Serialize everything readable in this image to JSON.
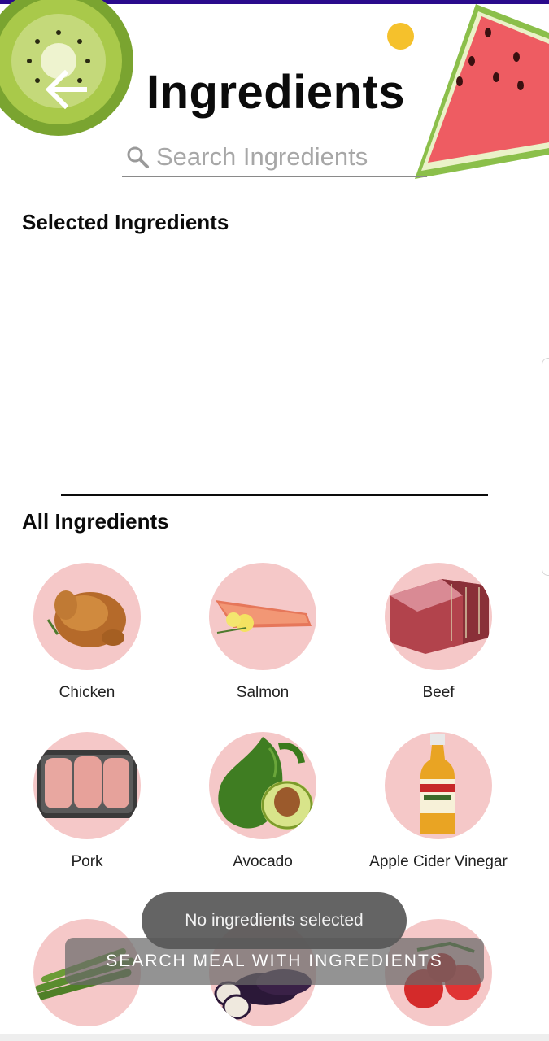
{
  "header": {
    "title": "Ingredients",
    "back_icon": "arrow-left-icon"
  },
  "search": {
    "placeholder": "Search Ingredients",
    "icon": "search-icon"
  },
  "selected_section": {
    "title": "Selected Ingredients"
  },
  "all_section": {
    "title": "All Ingredients",
    "items": [
      {
        "label": "Chicken"
      },
      {
        "label": "Salmon"
      },
      {
        "label": "Beef"
      },
      {
        "label": "Pork"
      },
      {
        "label": "Avocado"
      },
      {
        "label": "Apple Cider Vinegar"
      },
      {
        "label": ""
      },
      {
        "label": ""
      },
      {
        "label": ""
      }
    ]
  },
  "action_button": {
    "label": "SEARCH MEAL WITH INGREDIENTS"
  },
  "toast": {
    "message": "No ingredients selected"
  },
  "colors": {
    "accent_bar": "#2a0a8c",
    "ingredient_circle": "#f5c8c8"
  }
}
